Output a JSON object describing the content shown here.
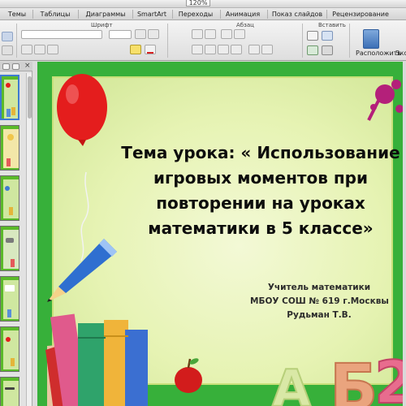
{
  "toolbar": {
    "zoom": "120%"
  },
  "ribbon_tabs": [
    "Темы",
    "Таблицы",
    "Диаграммы",
    "SmartArt",
    "Переходы",
    "Анимация",
    "Показ слайдов",
    "Рецензирование"
  ],
  "ribbon": {
    "font_group": "Шрифт",
    "paragraph_group": "Абзац",
    "insert_group": "Вставить",
    "arrange_button": "Расположить",
    "cut_off_button": "Экс"
  },
  "slide": {
    "title_lines": [
      "Тема урока: « Использование",
      "игровых моментов при",
      "повторении на уроках",
      "математики в 5 классе»"
    ],
    "author_lines": [
      "Учитель математики",
      "МБОУ СОШ № 619 г.Москвы",
      "Рудьман Т.В."
    ],
    "corner_letters": "АБ2"
  },
  "colors": {
    "slide_border": "#37b03a",
    "slide_inner": "#e6f3b3",
    "balloon": "#e41d1d",
    "selection": "#3e7bd1"
  }
}
